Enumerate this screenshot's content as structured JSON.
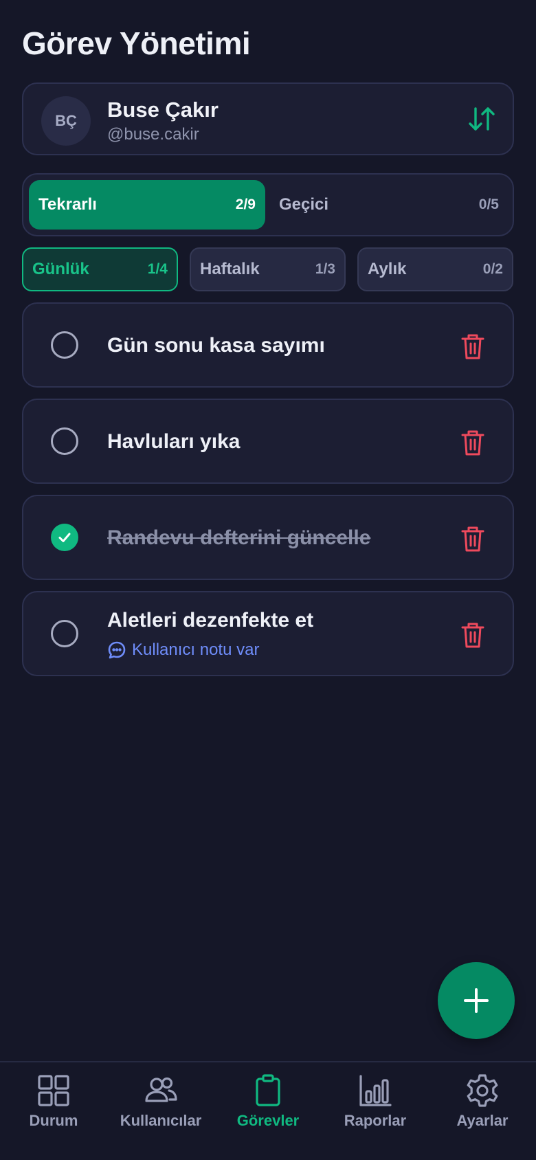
{
  "header": {
    "title": "Görev Yönetimi"
  },
  "user": {
    "initials": "BÇ",
    "name": "Buse Çakır",
    "handle": "@buse.cakir"
  },
  "task_types": [
    {
      "label": "Tekrarlı",
      "count": "2/9",
      "active": true
    },
    {
      "label": "Geçici",
      "count": "0/5",
      "active": false
    }
  ],
  "frequency_tabs": [
    {
      "label": "Günlük",
      "count": "1/4",
      "active": true
    },
    {
      "label": "Haftalık",
      "count": "1/3",
      "active": false
    },
    {
      "label": "Aylık",
      "count": "0/2",
      "active": false
    }
  ],
  "tasks": [
    {
      "title": "Gün sonu kasa sayımı",
      "completed": false
    },
    {
      "title": "Havluları yıka",
      "completed": false
    },
    {
      "title": "Randevu defterini güncelle",
      "completed": true
    },
    {
      "title": "Aletleri dezenfekte et",
      "completed": false,
      "note": "Kullanıcı notu var"
    }
  ],
  "bottom_nav": [
    {
      "label": "Durum",
      "icon": "grid-icon",
      "active": false
    },
    {
      "label": "Kullanıcılar",
      "icon": "users-icon",
      "active": false
    },
    {
      "label": "Görevler",
      "icon": "clipboard-icon",
      "active": true
    },
    {
      "label": "Raporlar",
      "icon": "bar-chart-icon",
      "active": false
    },
    {
      "label": "Ayarlar",
      "icon": "gear-icon",
      "active": false
    }
  ],
  "colors": {
    "accent": "#10b981",
    "accent_dark": "#058a63",
    "danger": "#ef4a5d",
    "link": "#6f8dfa",
    "background": "#151728",
    "card": "#1c1e33"
  }
}
